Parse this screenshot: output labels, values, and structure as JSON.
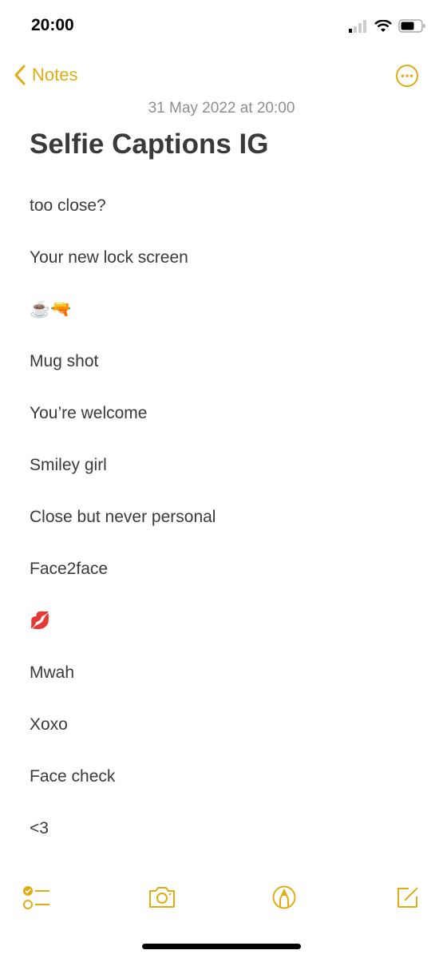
{
  "status_bar": {
    "time": "20:00"
  },
  "nav": {
    "back_label": "Notes"
  },
  "note": {
    "date": "31 May 2022 at 20:00",
    "title": "Selfie Captions IG",
    "lines": [
      "too close?",
      "Your new lock screen",
      "☕🔫",
      "Mug shot",
      "You’re welcome",
      "Smiley girl",
      "Close but never personal",
      "Face2face",
      "💋",
      "Mwah",
      "Xoxo",
      "Face check",
      "<3"
    ]
  },
  "colors": {
    "accent": "#e0ac14",
    "text": "#3a3a3a",
    "secondary": "#8e8e93"
  },
  "toolbar": {
    "icons": [
      "checklist-icon",
      "camera-icon",
      "markup-icon",
      "compose-icon"
    ]
  }
}
